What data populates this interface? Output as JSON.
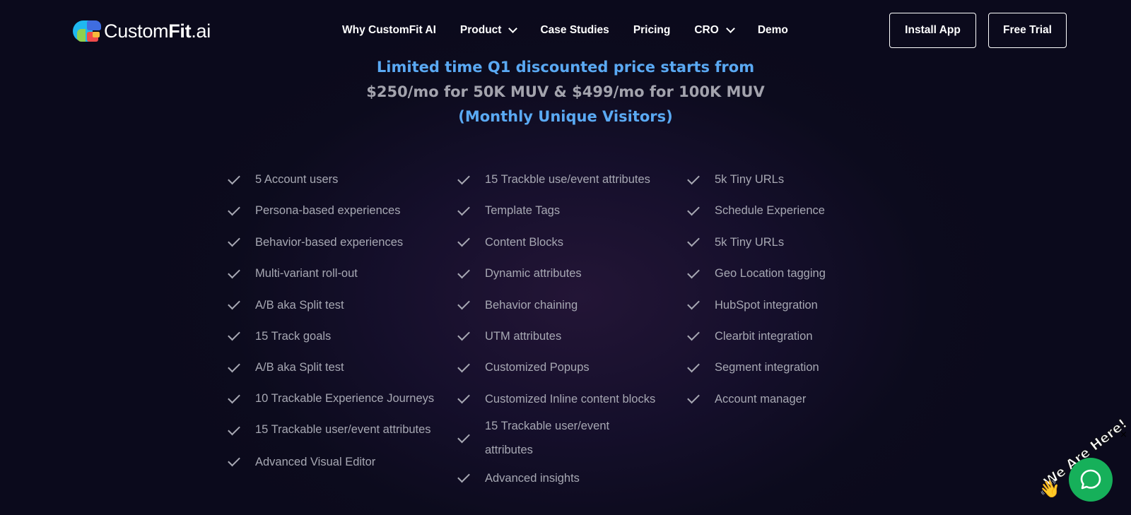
{
  "nav": {
    "logo": {
      "custom": "Custom",
      "fit": "Fit",
      "ai": ".ai"
    },
    "menu": [
      {
        "label": "Why CustomFit AI",
        "has_dropdown": false
      },
      {
        "label": "Product",
        "has_dropdown": true
      },
      {
        "label": "Case Studies",
        "has_dropdown": false
      },
      {
        "label": "Pricing",
        "has_dropdown": false
      },
      {
        "label": "CRO",
        "has_dropdown": true
      },
      {
        "label": "Demo",
        "has_dropdown": false
      }
    ],
    "install_label": "Install App",
    "trial_label": "Free Trial"
  },
  "headline": {
    "line1": "Limited time Q1 discounted price starts from",
    "line2": "$250/mo for 50K MUV & $499/mo for 100K MUV",
    "line3": "(Monthly Unique Visitors)"
  },
  "features": {
    "col1": [
      "5 Account users",
      "Persona-based experiences",
      "Behavior-based experiences",
      "Multi-variant roll-out",
      "A/B aka Split test",
      "15 Track goals",
      "A/B aka Split test",
      "10 Trackable Experience Journeys",
      "15 Trackable user/event attributes",
      "Advanced Visual Editor"
    ],
    "col2": [
      "15 Trackble use/event attributes",
      "Template Tags",
      "Content Blocks",
      "Dynamic attributes",
      "Behavior chaining",
      "UTM attributes",
      "Customized Popups",
      "Customized Inline content blocks",
      "15 Trackable user/event attributes",
      "Advanced insights"
    ],
    "col3": [
      "5k Tiny URLs",
      "Schedule Experience",
      "5k Tiny URLs",
      "Geo Location tagging",
      "HubSpot integration",
      "Clearbit integration",
      "Segment integration",
      "Account manager"
    ]
  },
  "chat_widget": {
    "text": "We Are Here!",
    "close": "×",
    "wave": "👋"
  },
  "colors": {
    "accent": "#5aa9f3",
    "muted": "#a7a8b3",
    "chat": "#16b05a",
    "bg": "#0b0a1c"
  }
}
